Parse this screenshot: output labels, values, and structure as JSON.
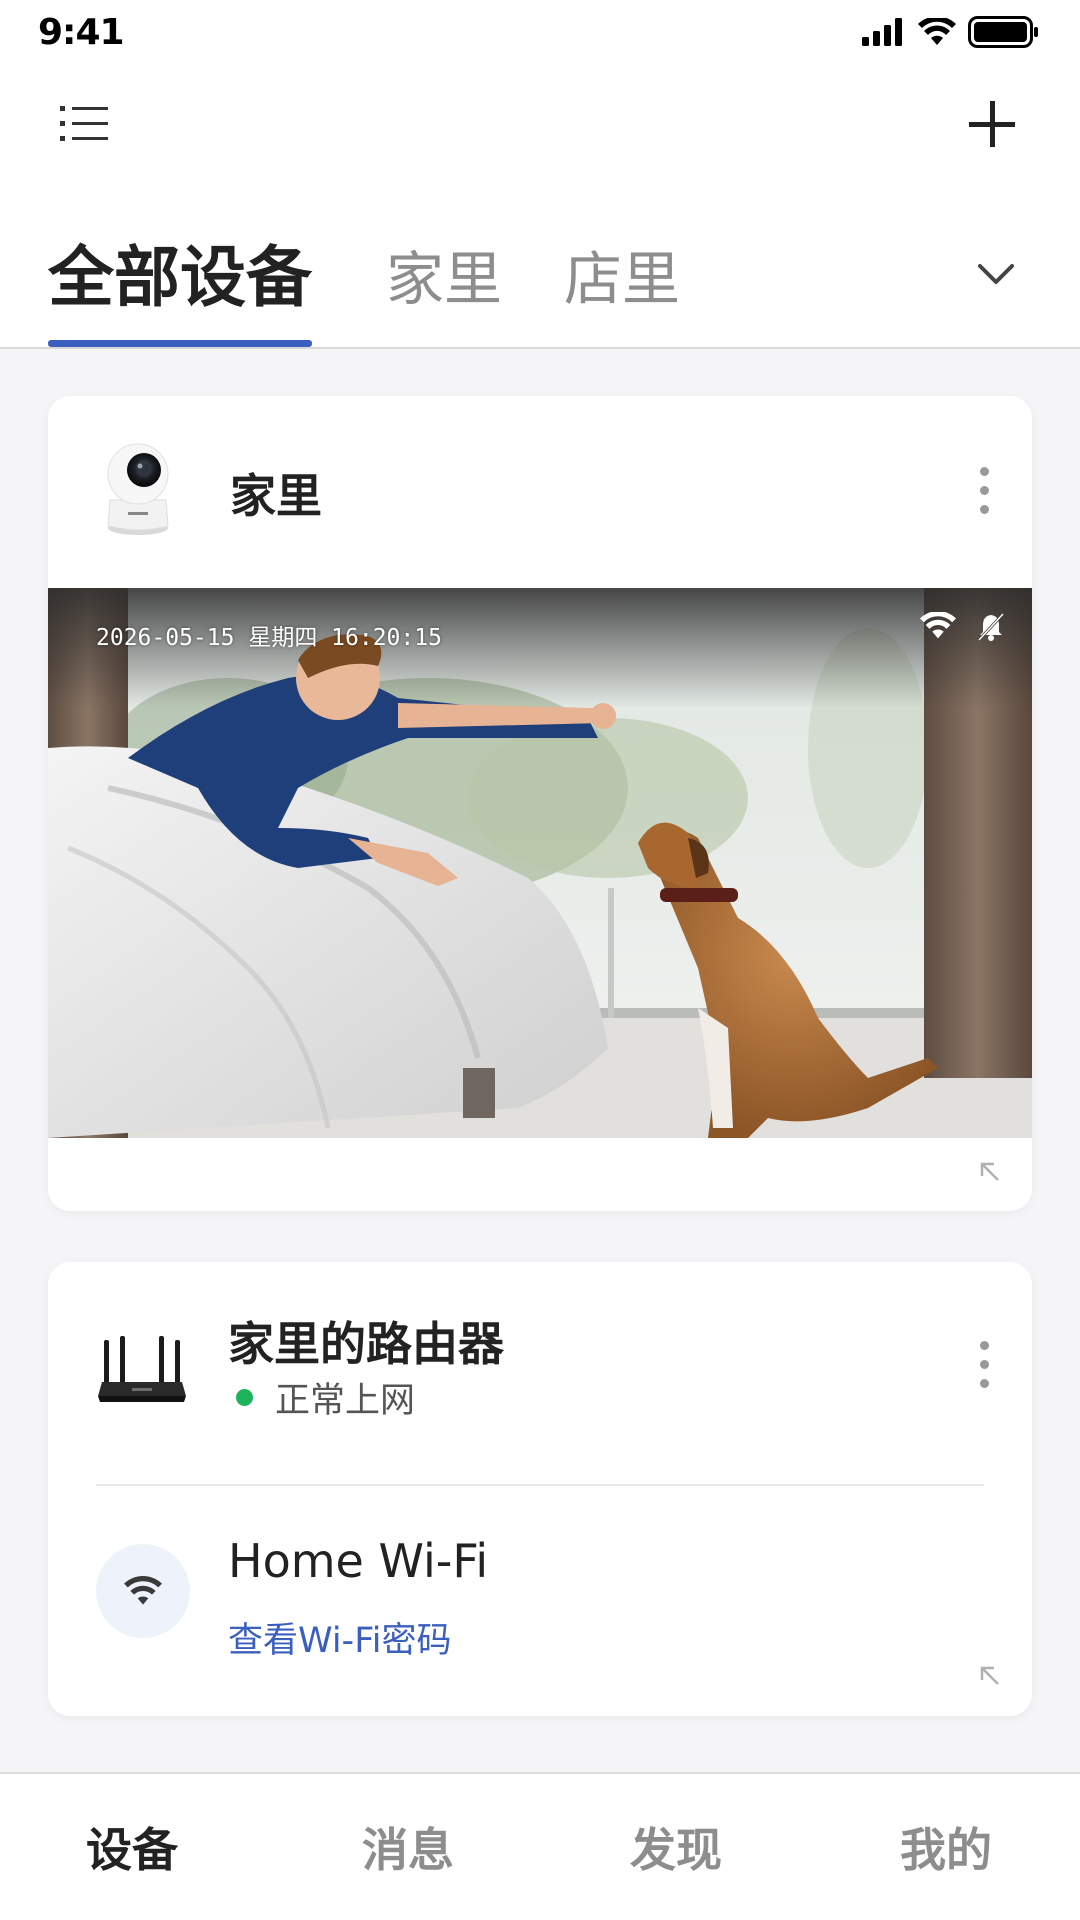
{
  "status_bar": {
    "time": "9:41",
    "icons": [
      "cellular-signal-icon",
      "wifi-icon",
      "battery-icon"
    ]
  },
  "toolbar": {
    "menu_icon": "list-icon",
    "add_icon": "plus-icon"
  },
  "tabs": [
    {
      "label": "全部设备",
      "active": true
    },
    {
      "label": "家里",
      "active": false
    },
    {
      "label": "店里",
      "active": false
    }
  ],
  "tabs_dropdown_icon": "chevron-down-icon",
  "camera_card": {
    "device_name": "家里",
    "device_icon": "security-camera-icon",
    "osd_timestamp": "2026-05-15 星期四 16:20:15",
    "osd_icons": [
      "wifi-icon",
      "bell-muted-icon"
    ],
    "preview_description_icon": "live-preview-image",
    "more_icon": "more-vertical-icon",
    "expand_icon": "expand-arrow-icon"
  },
  "router_card": {
    "device_name": "家里的路由器",
    "status_text": "正常上网",
    "status_color": "#1fb35b",
    "wifi_name": "Home Wi-Fi",
    "wifi_link": "查看Wi-Fi密码",
    "accent_color": "#3b5fbf"
  },
  "bottom_nav": [
    {
      "label": "设备",
      "active": true
    },
    {
      "label": "消息",
      "active": false
    },
    {
      "label": "发现",
      "active": false
    },
    {
      "label": "我的",
      "active": false
    }
  ]
}
